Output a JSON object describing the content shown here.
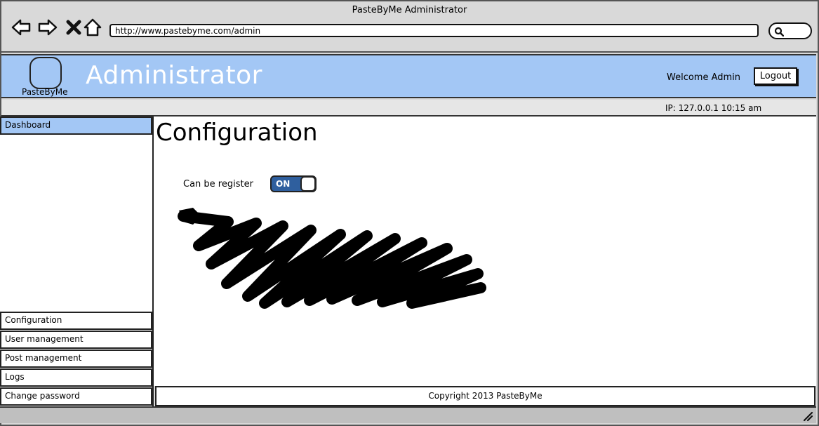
{
  "window": {
    "title": "PasteByMe Administrator"
  },
  "browser": {
    "url": "http://www.pastebyme.com/admin"
  },
  "header": {
    "logo_label": "PasteByMe",
    "title": "Administrator",
    "welcome": "Welcome Admin",
    "logout_label": "Logout"
  },
  "status": {
    "ip_time": "IP: 127.0.0.1  10:15 am"
  },
  "sidebar": {
    "items": [
      {
        "label": "Dashboard"
      },
      {
        "label": "Configuration"
      },
      {
        "label": "User management"
      },
      {
        "label": "Post management"
      },
      {
        "label": "Logs"
      },
      {
        "label": "Change password"
      }
    ]
  },
  "main": {
    "title": "Configuration",
    "register_label": "Can be register",
    "register_toggle": "ON"
  },
  "footer": {
    "copyright": "Copyright 2013 PasteByMe"
  },
  "colors": {
    "header_bg": "#a3c7f5",
    "toggle_on": "#2f5f9e",
    "active_item": "#a3c7f5"
  }
}
